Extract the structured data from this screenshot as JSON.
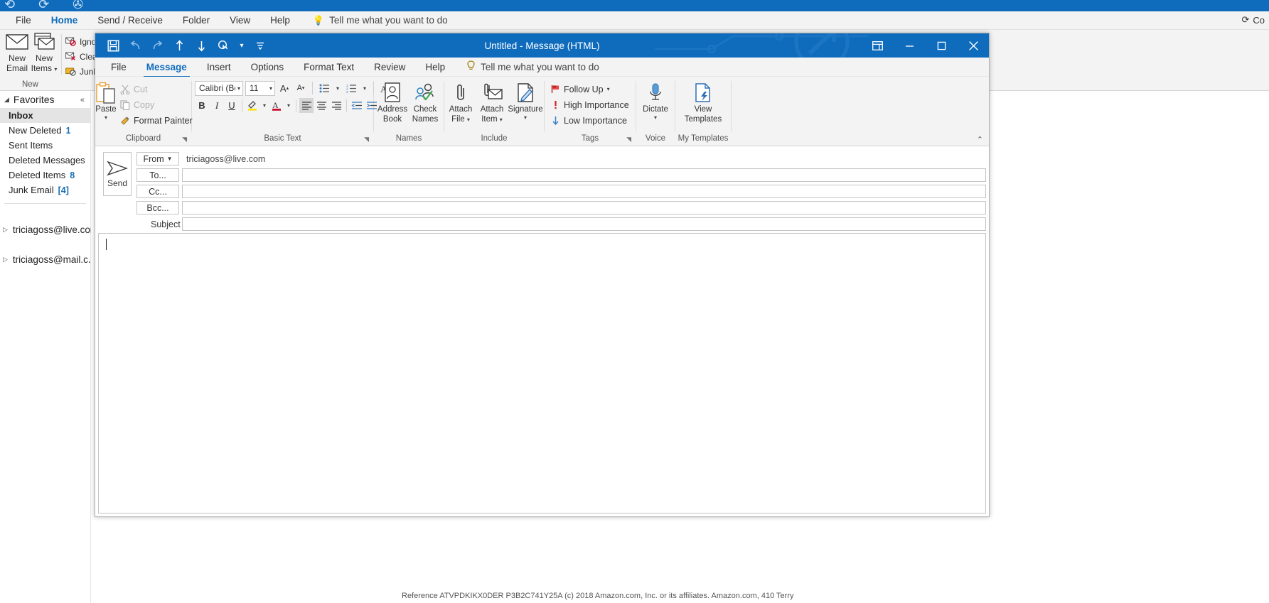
{
  "outlook": {
    "menu": [
      {
        "label": "File",
        "active": false
      },
      {
        "label": "Home",
        "active": true
      },
      {
        "label": "Send / Receive",
        "active": false
      },
      {
        "label": "Folder",
        "active": false
      },
      {
        "label": "View",
        "active": false
      },
      {
        "label": "Help",
        "active": false
      }
    ],
    "tellme": "Tell me what you want to do",
    "connected": "Co",
    "ribbon": {
      "new_email": "New\nEmail",
      "new_email_l1": "New",
      "new_email_l2": "Email",
      "new_items_l1": "New",
      "new_items_l2": "Items",
      "group_new": "New",
      "delete_items": [
        {
          "label": "Igno",
          "icon": "ignore-icon"
        },
        {
          "label": "Clea",
          "icon": "clean-up-icon"
        },
        {
          "label": "Junk",
          "icon": "junk-icon"
        }
      ]
    },
    "sidebar": {
      "favorites_label": "Favorites",
      "items": [
        {
          "label": "Inbox",
          "count": "",
          "selected": true
        },
        {
          "label": "New Deleted",
          "count": "1",
          "selected": false
        },
        {
          "label": "Sent Items",
          "count": "",
          "selected": false
        },
        {
          "label": "Deleted Messages",
          "count": "",
          "selected": false
        },
        {
          "label": "Deleted Items",
          "count": "8",
          "selected": false
        },
        {
          "label": "Junk Email",
          "count": "[4]",
          "selected": false
        }
      ],
      "accounts": [
        {
          "label": "triciagoss@live.com"
        },
        {
          "label": "triciagoss@mail.c..."
        }
      ]
    },
    "footer_note": "Reference ATVPDKIKX0DER P3B2C741Y25A  (c) 2018 Amazon.com, Inc. or its affiliates. Amazon.com, 410 Terry"
  },
  "compose": {
    "title": "Untitled  -  Message (HTML)",
    "quick_access": [
      {
        "name": "save-icon",
        "glyph": "ὋE",
        "dim": false
      },
      {
        "name": "undo-icon",
        "glyph": "↶",
        "dim": true
      },
      {
        "name": "redo-icon",
        "glyph": "↷",
        "dim": true
      },
      {
        "name": "previous-item-icon",
        "glyph": "↑",
        "dim": false
      },
      {
        "name": "next-item-icon",
        "glyph": "↓",
        "dim": false
      },
      {
        "name": "touch-mode-icon",
        "glyph": "☝",
        "dim": false
      }
    ],
    "window_buttons": [
      {
        "name": "ribbon-display-options",
        "glyph": "⬚"
      },
      {
        "name": "minimize",
        "glyph": "─"
      },
      {
        "name": "maximize",
        "glyph": "□"
      },
      {
        "name": "close",
        "glyph": "✕"
      }
    ],
    "tabs": [
      {
        "label": "File",
        "active": false
      },
      {
        "label": "Message",
        "active": true
      },
      {
        "label": "Insert",
        "active": false
      },
      {
        "label": "Options",
        "active": false
      },
      {
        "label": "Format Text",
        "active": false
      },
      {
        "label": "Review",
        "active": false
      },
      {
        "label": "Help",
        "active": false
      }
    ],
    "tellme": "Tell me what you want to do",
    "groups": {
      "clipboard": {
        "label": "Clipboard",
        "paste": "Paste",
        "cut": "Cut",
        "copy": "Copy",
        "format_painter": "Format Painter"
      },
      "basic_text": {
        "label": "Basic Text",
        "font_name": "Calibri (Bod",
        "font_size": "11",
        "grow_font": "A",
        "shrink_font": "A",
        "bold": "B",
        "italic": "I",
        "underline": "U",
        "highlight": "✎",
        "font_color": "A",
        "bullets": "≡",
        "numbering": "≡",
        "clear_formatting": "A",
        "align_left": "≡",
        "align_center": "≡",
        "align_right": "≡",
        "decrease_indent": "←",
        "increase_indent": "→"
      },
      "names": {
        "label": "Names",
        "address_book_l1": "Address",
        "address_book_l2": "Book",
        "check_names_l1": "Check",
        "check_names_l2": "Names"
      },
      "include": {
        "label": "Include",
        "attach_file_l1": "Attach",
        "attach_file_l2": "File",
        "attach_item_l1": "Attach",
        "attach_item_l2": "Item",
        "signature": "Signature"
      },
      "tags": {
        "label": "Tags",
        "follow_up": "Follow Up",
        "high_importance": "High Importance",
        "low_importance": "Low Importance"
      },
      "voice": {
        "label": "Voice",
        "dictate": "Dictate"
      },
      "my_templates": {
        "label": "My Templates",
        "view_l1": "View",
        "view_l2": "Templates"
      }
    },
    "header": {
      "send_label": "Send",
      "from_label": "From",
      "from_value": "triciagoss@live.com",
      "to_label": "To...",
      "to_value": "",
      "cc_label": "Cc...",
      "cc_value": "",
      "bcc_label": "Bcc...",
      "bcc_value": "",
      "subject_label": "Subject",
      "subject_value": ""
    },
    "body_value": ""
  },
  "colors": {
    "accent": "#0f6cbd",
    "ribbon_bg": "#f3f3f3",
    "count_blue": "#1a6fb5",
    "red": "#c8102e",
    "yellow": "#ffe600"
  }
}
